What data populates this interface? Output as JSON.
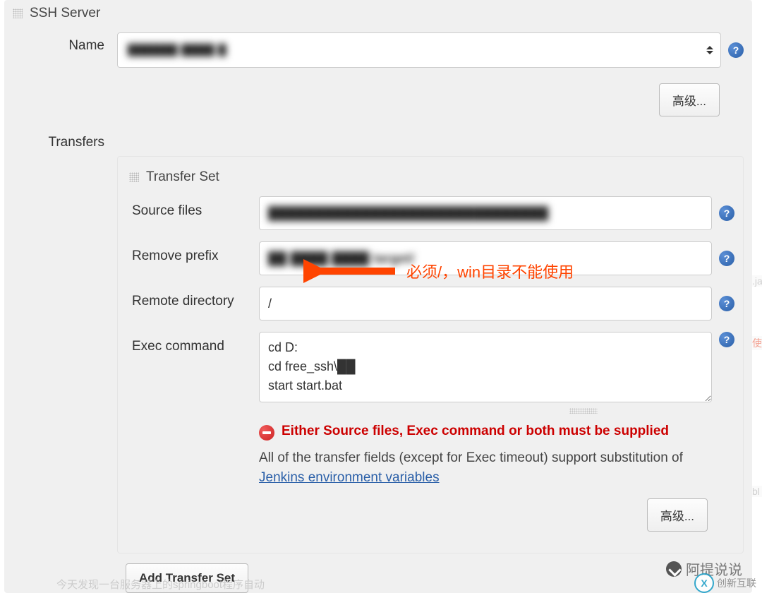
{
  "ssh": {
    "section_title": "SSH Server",
    "name_label": "Name",
    "name_value": "██████ ████ █",
    "advanced_btn": "高级..."
  },
  "transfers": {
    "label": "Transfers",
    "set_title": "Transfer Set",
    "source_files_label": "Source files",
    "source_files_value": "██████████████████████████████",
    "remove_prefix_label": "Remove prefix",
    "remove_prefix_value": "██ ████ ████ target/",
    "remote_dir_label": "Remote directory",
    "remote_dir_value": "/",
    "exec_cmd_label": "Exec command",
    "exec_cmd_value": "cd D:\ncd free_ssh\\██\nstart start.bat",
    "error_msg": "Either Source files, Exec command or both must be supplied",
    "info_prefix": "All of the transfer fields (except for Exec timeout) support substitution of ",
    "info_link": "Jenkins environment variables",
    "advanced_btn": "高级...",
    "add_set_btn": "Add Transfer Set"
  },
  "annotation": {
    "text": "必须/，win目录不能使用"
  },
  "watermark": {
    "text1": "阿提说说",
    "text2": "创新互联"
  },
  "faded_text": "今天发现一台服务器上的springboot程序自动",
  "side": {
    "a": ".ja",
    "b": "使",
    "c": "bl"
  }
}
